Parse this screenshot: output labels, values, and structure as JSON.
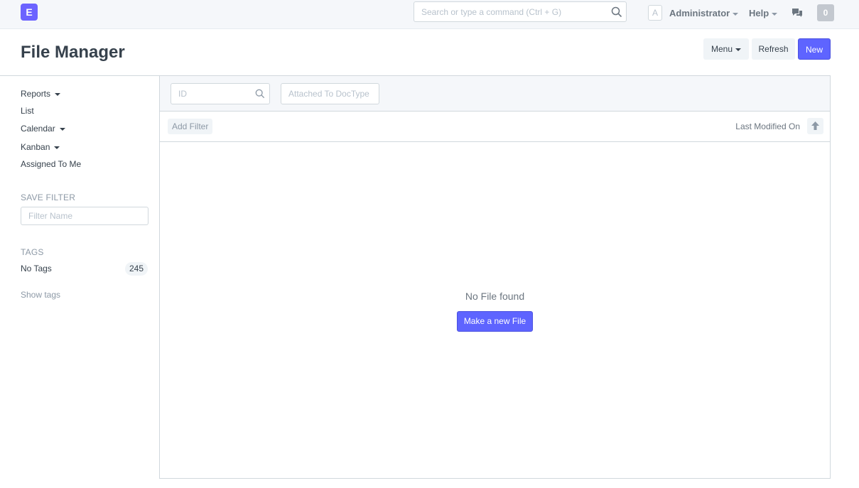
{
  "navbar": {
    "logo_letter": "E",
    "search_placeholder": "Search or type a command (Ctrl + G)",
    "avatar_letter": "A",
    "user_name": "Administrator",
    "help_label": "Help",
    "notification_count": "0"
  },
  "page": {
    "title": "File Manager",
    "menu_label": "Menu",
    "refresh_label": "Refresh",
    "new_label": "New"
  },
  "sidebar": {
    "items": [
      {
        "label": "Reports"
      },
      {
        "label": "List"
      },
      {
        "label": "Calendar"
      },
      {
        "label": "Kanban"
      },
      {
        "label": "Assigned To Me"
      }
    ],
    "save_filter_heading": "SAVE FILTER",
    "filter_name_placeholder": "Filter Name",
    "tags_heading": "TAGS",
    "no_tags_label": "No Tags",
    "no_tags_count": "245",
    "show_tags_label": "Show tags"
  },
  "list": {
    "id_placeholder": "ID",
    "doctype_placeholder": "Attached To DocType",
    "add_filter_label": "Add Filter",
    "sort_label": "Last Modified On",
    "empty_message": "No File found",
    "make_new_label": "Make a new File"
  },
  "colors": {
    "primary": "#5e64ff",
    "logo": "#6c63ff",
    "navbar_bg": "#f5f7fa"
  }
}
